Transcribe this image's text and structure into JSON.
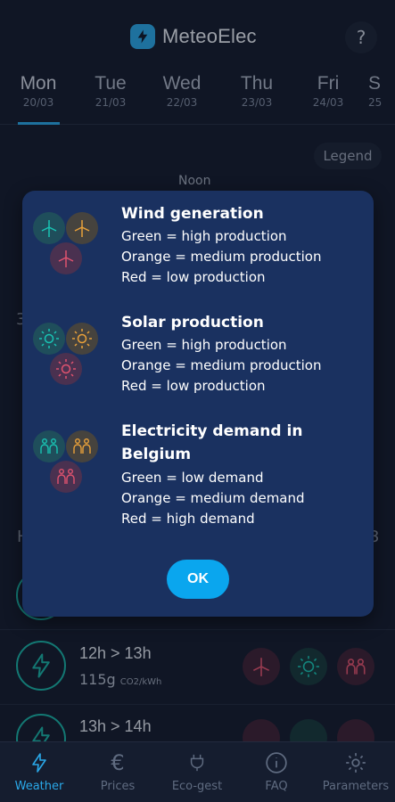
{
  "header": {
    "app_name": "MeteoElec",
    "help_label": "?"
  },
  "days": [
    {
      "name": "Mon",
      "date": "20/03",
      "active": true
    },
    {
      "name": "Tue",
      "date": "21/03"
    },
    {
      "name": "Wed",
      "date": "22/03"
    },
    {
      "name": "Thu",
      "date": "23/03"
    },
    {
      "name": "Fri",
      "date": "24/03"
    },
    {
      "name": "S",
      "date": "25"
    }
  ],
  "legend_button": "Legend",
  "noon_label": "Noon",
  "background": {
    "frag_left": "H",
    "frag_right": "3",
    "frag_mid": "3"
  },
  "rows": [
    {
      "time": "12h > 13h",
      "co2_value": "115g",
      "co2_unit": "CO2/kWh"
    },
    {
      "time": "13h > 14h"
    }
  ],
  "modal": {
    "sections": [
      {
        "title": "Wind generation",
        "lines": [
          "Green = high production",
          "Orange = medium production",
          "Red = low production"
        ],
        "icon": "wind-turbine-icon"
      },
      {
        "title": "Solar production",
        "lines": [
          "Green = high production",
          "Orange = medium production",
          "Red = low production"
        ],
        "icon": "sun-icon"
      },
      {
        "title": "Electricity demand in Belgium",
        "lines": [
          "Green = low demand",
          "Orange = medium demand",
          "Red = high demand"
        ],
        "icon": "people-icon"
      }
    ],
    "ok_label": "OK"
  },
  "colors": {
    "green": "#19c3b3",
    "orange": "#e9a13a",
    "red": "#e0536f",
    "accent": "#2aa8e8"
  },
  "nav": [
    {
      "label": "Weather",
      "icon": "bolt-icon",
      "active": true
    },
    {
      "label": "Prices",
      "icon": "euro-icon"
    },
    {
      "label": "Eco-gest",
      "icon": "plug-icon"
    },
    {
      "label": "FAQ",
      "icon": "info-icon"
    },
    {
      "label": "Parameters",
      "icon": "gear-icon"
    }
  ]
}
